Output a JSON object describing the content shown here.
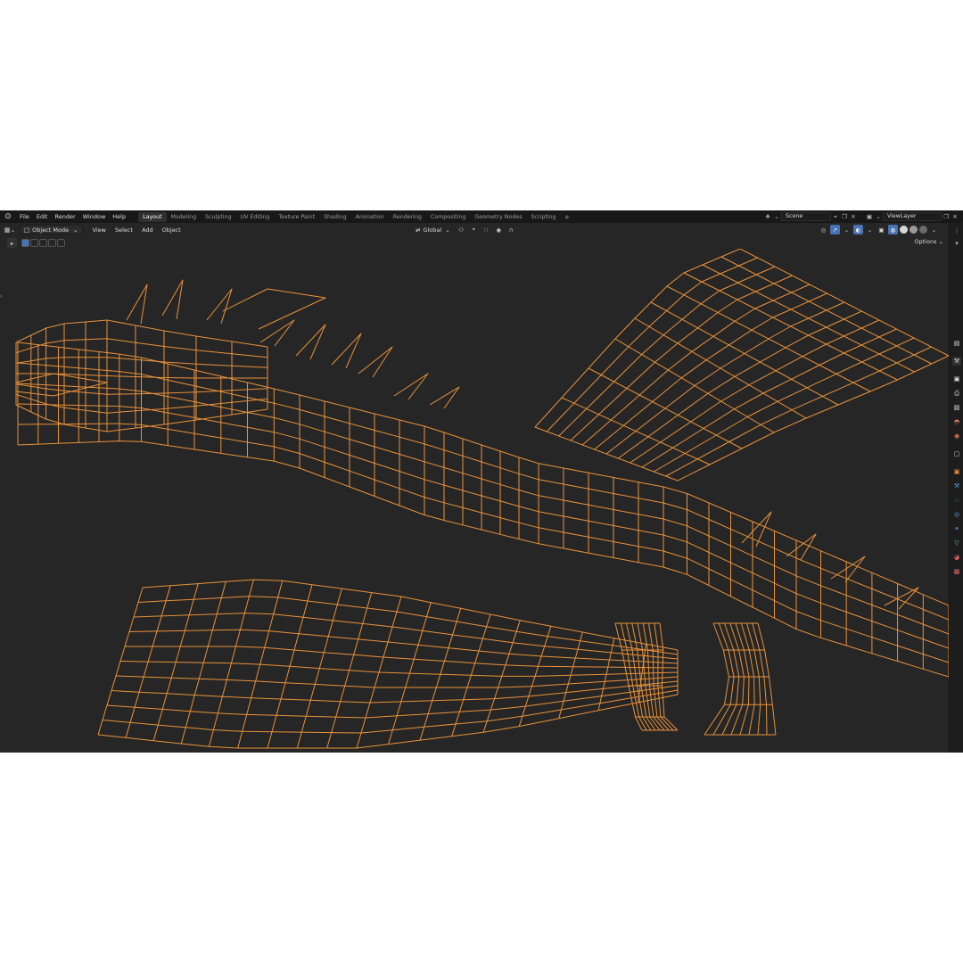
{
  "app": {
    "logo_icon": "blender-logo-icon",
    "menu": [
      "File",
      "Edit",
      "Render",
      "Window",
      "Help"
    ],
    "workspaces": [
      {
        "label": "Layout",
        "active": true
      },
      {
        "label": "Modeling",
        "active": false
      },
      {
        "label": "Sculpting",
        "active": false
      },
      {
        "label": "UV Editing",
        "active": false
      },
      {
        "label": "Texture Paint",
        "active": false
      },
      {
        "label": "Shading",
        "active": false
      },
      {
        "label": "Animation",
        "active": false
      },
      {
        "label": "Rendering",
        "active": false
      },
      {
        "label": "Compositing",
        "active": false
      },
      {
        "label": "Geometry Nodes",
        "active": false
      },
      {
        "label": "Scripting",
        "active": false
      }
    ],
    "workspace_add": "+",
    "scene_value": "Scene",
    "viewlayer_value": "ViewLayer"
  },
  "viewport_header": {
    "mode": "Object Mode",
    "menus": [
      "View",
      "Select",
      "Add",
      "Object"
    ],
    "transform_orientation": "Global",
    "options_label": "Options"
  },
  "colors": {
    "wire": "#e8913a",
    "background": "#262626",
    "topbar": "#181818",
    "accent": "#4772b3"
  }
}
